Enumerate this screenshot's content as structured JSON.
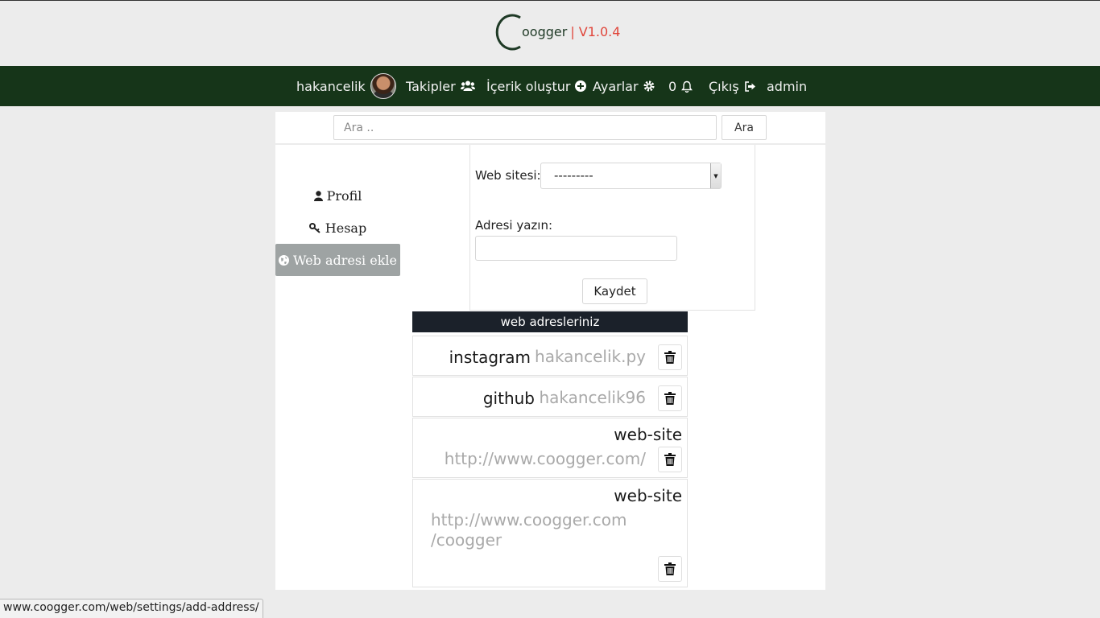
{
  "brand": {
    "name": "oogger",
    "version": "| V1.0.4",
    "accent_color": "#e0453a",
    "dark_green": "#163519"
  },
  "nav": {
    "username": "hakancelik",
    "follows": "Takipler",
    "create_content": "İçerik oluştur",
    "settings": "Ayarlar",
    "notification_count": "0",
    "logout": "Çıkış",
    "admin": "admin"
  },
  "search": {
    "placeholder": "Ara ..",
    "button": "Ara"
  },
  "sidebar": {
    "items": [
      {
        "label": "Profil",
        "icon": "user-icon"
      },
      {
        "label": "Hesap",
        "icon": "key-icon"
      },
      {
        "label": "Web adresi ekle",
        "icon": "globe-icon",
        "active": true
      }
    ]
  },
  "form": {
    "website_label": "Web sitesi:",
    "website_value": "---------",
    "address_label": "Adresi yazın:",
    "address_value": "",
    "save_button": "Kaydet"
  },
  "addresses": {
    "header": "web adresleriniz",
    "items": [
      {
        "site": "instagram",
        "url": "hakancelik.py"
      },
      {
        "site": "github",
        "url": "hakancelik96"
      },
      {
        "site": "web-site",
        "url": "http://www.coogger.com/"
      },
      {
        "site": "web-site",
        "url_line1": "http://www.coogger.com",
        "url_line2": "/coogger"
      }
    ]
  },
  "status_bar": {
    "url": "www.coogger.com/web/settings/add-address/"
  }
}
